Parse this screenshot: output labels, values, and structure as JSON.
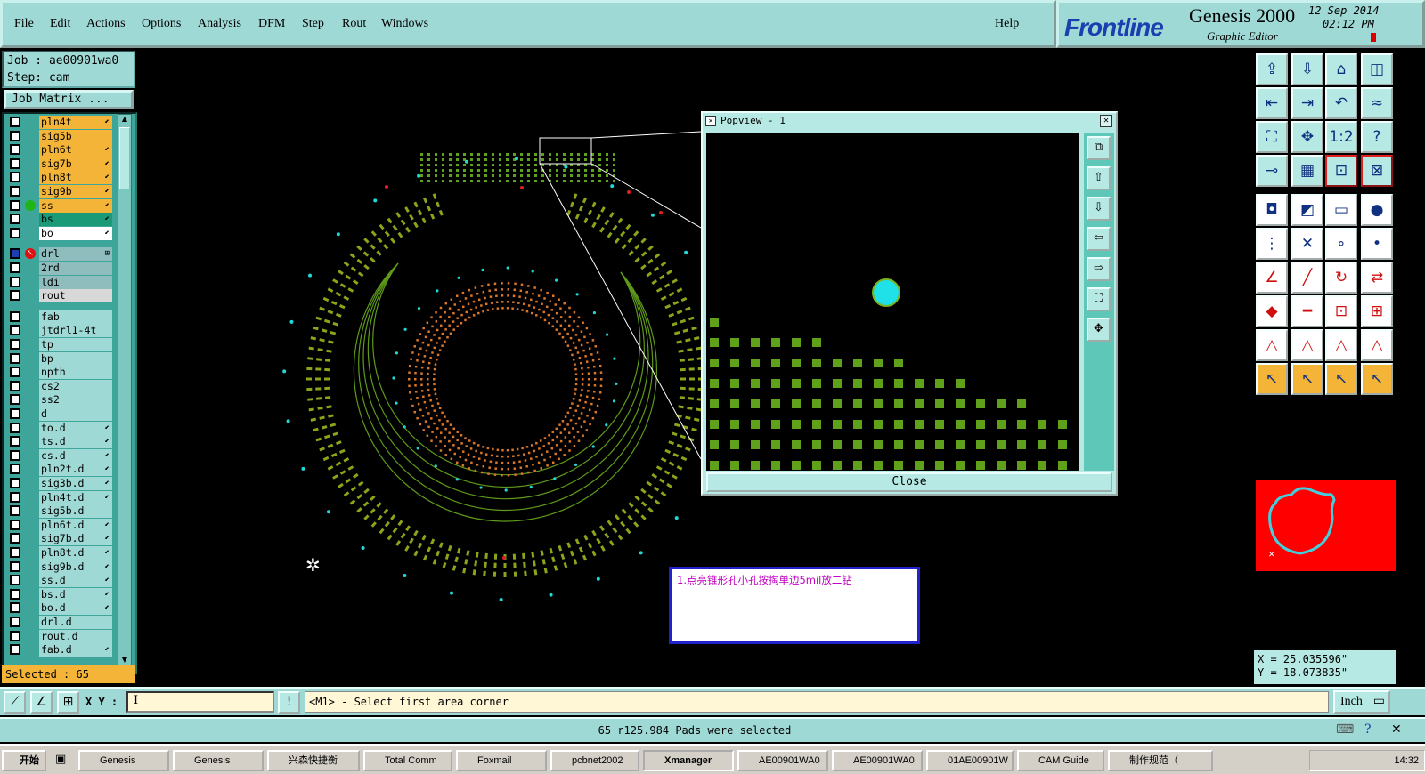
{
  "menubar": {
    "items": [
      "File",
      "Edit",
      "Actions",
      "Options",
      "Analysis",
      "DFM",
      "Step",
      "Rout",
      "Windows"
    ],
    "help": "Help"
  },
  "brand": {
    "logo": "Frontline",
    "product": "Genesis 2000",
    "subtitle": "Graphic Editor",
    "date": "12 Sep 2014",
    "time": "02:12 PM"
  },
  "job": {
    "job_line": "Job : ae00901wa0",
    "step_line": "Step: cam",
    "matrix_button": "Job Matrix ..."
  },
  "layers": [
    {
      "name": "pln4t",
      "color": "#f3b437",
      "tag": "⬋"
    },
    {
      "name": "sig5b",
      "color": "#f3b437",
      "tag": ""
    },
    {
      "name": "pln6t",
      "color": "#f3b437",
      "tag": "⬋"
    },
    {
      "name": "sig7b",
      "color": "#f3b437",
      "tag": "⬋"
    },
    {
      "name": "pln8t",
      "color": "#f3b437",
      "tag": "⬋"
    },
    {
      "name": "sig9b",
      "color": "#f3b437",
      "tag": "⬋"
    },
    {
      "name": "ss",
      "color": "#f3b437",
      "tag": "⬋"
    },
    {
      "name": "bs",
      "color": "#1a9a76",
      "tag": "⬋"
    },
    {
      "name": "bo",
      "color": "#ffffff",
      "tag": "⬋"
    },
    {
      "name": "drl",
      "color": "#8fbcbc",
      "tag": "⊞"
    },
    {
      "name": "2rd",
      "color": "#8fbcbc",
      "tag": ""
    },
    {
      "name": "ldi",
      "color": "#8fbcbc",
      "tag": ""
    },
    {
      "name": "rout",
      "color": "#d8d8d8",
      "tag": ""
    },
    {
      "name": "fab",
      "color": "#9fd9d5",
      "tag": ""
    },
    {
      "name": "jtdrl1-4t",
      "color": "#9fd9d5",
      "tag": ""
    },
    {
      "name": "tp",
      "color": "#9fd9d5",
      "tag": ""
    },
    {
      "name": "bp",
      "color": "#9fd9d5",
      "tag": ""
    },
    {
      "name": "npth",
      "color": "#9fd9d5",
      "tag": ""
    },
    {
      "name": "cs2",
      "color": "#9fd9d5",
      "tag": ""
    },
    {
      "name": "ss2",
      "color": "#9fd9d5",
      "tag": ""
    },
    {
      "name": "d",
      "color": "#9fd9d5",
      "tag": ""
    },
    {
      "name": "to.d",
      "color": "#9fd9d5",
      "tag": "⬋"
    },
    {
      "name": "ts.d",
      "color": "#9fd9d5",
      "tag": "⬋"
    },
    {
      "name": "cs.d",
      "color": "#9fd9d5",
      "tag": "⬋"
    },
    {
      "name": "pln2t.d",
      "color": "#9fd9d5",
      "tag": "⬋"
    },
    {
      "name": "sig3b.d",
      "color": "#9fd9d5",
      "tag": "⬋"
    },
    {
      "name": "pln4t.d",
      "color": "#9fd9d5",
      "tag": "⬋"
    },
    {
      "name": "sig5b.d",
      "color": "#9fd9d5",
      "tag": ""
    },
    {
      "name": "pln6t.d",
      "color": "#9fd9d5",
      "tag": "⬋"
    },
    {
      "name": "sig7b.d",
      "color": "#9fd9d5",
      "tag": "⬋"
    },
    {
      "name": "pln8t.d",
      "color": "#9fd9d5",
      "tag": "⬋"
    },
    {
      "name": "sig9b.d",
      "color": "#9fd9d5",
      "tag": "⬋"
    },
    {
      "name": "ss.d",
      "color": "#9fd9d5",
      "tag": "⬋"
    },
    {
      "name": "bs.d",
      "color": "#9fd9d5",
      "tag": "⬋"
    },
    {
      "name": "bo.d",
      "color": "#9fd9d5",
      "tag": "⬋"
    },
    {
      "name": "drl.d",
      "color": "#9fd9d5",
      "tag": ""
    },
    {
      "name": "rout.d",
      "color": "#9fd9d5",
      "tag": ""
    },
    {
      "name": "fab.d",
      "color": "#9fd9d5",
      "tag": "⬋"
    }
  ],
  "selected_text": "Selected : 65",
  "popview": {
    "title": "Popview - 1",
    "close_label": "Close"
  },
  "note": "1.点亮锥形孔小孔按掏单边5mil放二钻",
  "coords": {
    "x_line": "X = 25.035596\"",
    "y_line": "Y = 18.073835\""
  },
  "cmdbar": {
    "xy_label": "X Y :",
    "xy_value": "I",
    "prompt": "<M1> - Select first area corner",
    "units": "Inch"
  },
  "status_text": "65 r125.984 Pads were selected",
  "taskbar": {
    "start": "开始",
    "items": [
      "Genesis",
      "Genesis",
      "兴森快捷衡",
      "Total Comm",
      "Foxmail",
      "pcbnet2002",
      "Xmanager",
      "AE00901WA0",
      "AE00901WA0",
      "01AE00901W",
      "CAM Guide",
      "制作规范（"
    ],
    "clock": "14:32"
  },
  "colors": {
    "panel": "#9fd9d5",
    "layer_active": "#f3b437",
    "pad_green": "#5fa11a",
    "drill_cyan": "#20d8d8"
  }
}
